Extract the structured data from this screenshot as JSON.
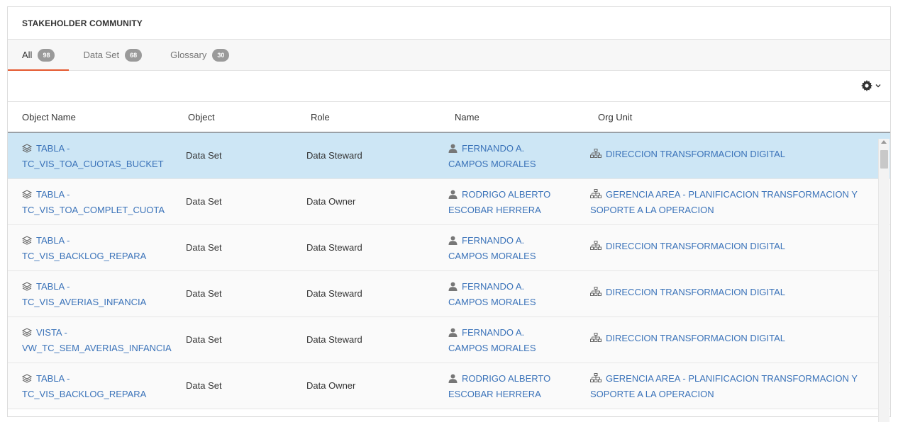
{
  "panel": {
    "title": "STAKEHOLDER COMMUNITY"
  },
  "tabs": [
    {
      "label": "All",
      "count": "98"
    },
    {
      "label": "Data Set",
      "count": "68"
    },
    {
      "label": "Glossary",
      "count": "30"
    }
  ],
  "toolbar": {
    "settings_icon": "gear-icon",
    "dropdown_icon": "chevron-down-icon"
  },
  "table": {
    "headers": [
      "Object Name",
      "Object",
      "Role",
      "Name",
      "Org Unit"
    ],
    "rows": [
      {
        "object_name_1": "TABLA -",
        "object_name_2": "TC_VIS_TOA_CUOTAS_BUCKET",
        "object": "Data Set",
        "role": "Data Steward",
        "name_1": "FERNANDO A.",
        "name_2": "CAMPOS MORALES",
        "org_1": "DIRECCION TRANSFORMACION DIGITAL",
        "org_2": ""
      },
      {
        "object_name_1": "TABLA -",
        "object_name_2": "TC_VIS_TOA_COMPLET_CUOTA",
        "object": "Data Set",
        "role": "Data Owner",
        "name_1": "RODRIGO ALBERTO",
        "name_2": "ESCOBAR HERRERA",
        "org_1": "GERENCIA AREA - PLANIFICACION TRANSFORMACION Y",
        "org_2": "SOPORTE A LA OPERACION"
      },
      {
        "object_name_1": "TABLA -",
        "object_name_2": "TC_VIS_BACKLOG_REPARA",
        "object": "Data Set",
        "role": "Data Steward",
        "name_1": "FERNANDO A.",
        "name_2": "CAMPOS MORALES",
        "org_1": "DIRECCION TRANSFORMACION DIGITAL",
        "org_2": ""
      },
      {
        "object_name_1": "TABLA -",
        "object_name_2": "TC_VIS_AVERIAS_INFANCIA",
        "object": "Data Set",
        "role": "Data Steward",
        "name_1": "FERNANDO A.",
        "name_2": "CAMPOS MORALES",
        "org_1": "DIRECCION TRANSFORMACION DIGITAL",
        "org_2": ""
      },
      {
        "object_name_1": "VISTA -",
        "object_name_2": "VW_TC_SEM_AVERIAS_INFANCIA",
        "object": "Data Set",
        "role": "Data Steward",
        "name_1": "FERNANDO A.",
        "name_2": "CAMPOS MORALES",
        "org_1": "DIRECCION TRANSFORMACION DIGITAL",
        "org_2": ""
      },
      {
        "object_name_1": "TABLA -",
        "object_name_2": "TC_VIS_BACKLOG_REPARA",
        "object": "Data Set",
        "role": "Data Owner",
        "name_1": "RODRIGO ALBERTO",
        "name_2": "ESCOBAR HERRERA",
        "org_1": "GERENCIA AREA - PLANIFICACION TRANSFORMACION Y",
        "org_2": "SOPORTE A LA OPERACION"
      }
    ]
  },
  "icons": {
    "dataset": "layers-icon",
    "person": "user-icon",
    "org": "org-chart-icon"
  },
  "colors": {
    "accent": "#e4572e",
    "link": "#3b73b9",
    "selected_row": "#cde6f5",
    "badge": "#9a9a9a"
  }
}
